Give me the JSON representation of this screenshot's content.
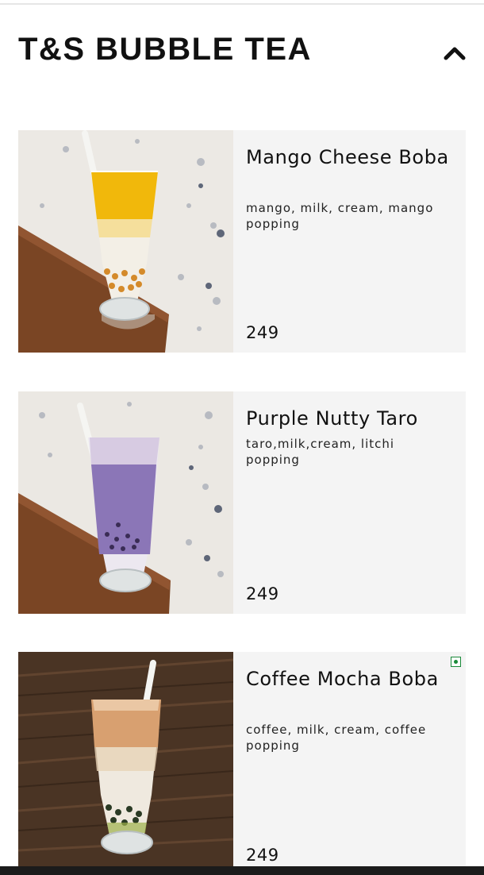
{
  "header": {
    "title": "T&S BUBBLE TEA",
    "collapse_icon": "chevron-up-icon"
  },
  "colors": {
    "card_background": "#f4f4f4",
    "veg_badge": "#1a8a3a",
    "bottom_bar": "#1b1b1b"
  },
  "menu": {
    "items": [
      {
        "name": "Mango Cheese Boba",
        "description": "mango, milk, cream, mango popping",
        "price": "249",
        "image": "mango-boba-drink-photo",
        "veg_badge": false
      },
      {
        "name": "Purple Nutty Taro",
        "description": "taro,milk,cream, litchi popping",
        "price": "249",
        "image": "taro-boba-drink-photo",
        "veg_badge": false
      },
      {
        "name": "Coffee Mocha Boba",
        "description": "coffee, milk, cream, coffee popping",
        "price": "249",
        "image": "coffee-boba-drink-photo",
        "veg_badge": true
      }
    ]
  }
}
